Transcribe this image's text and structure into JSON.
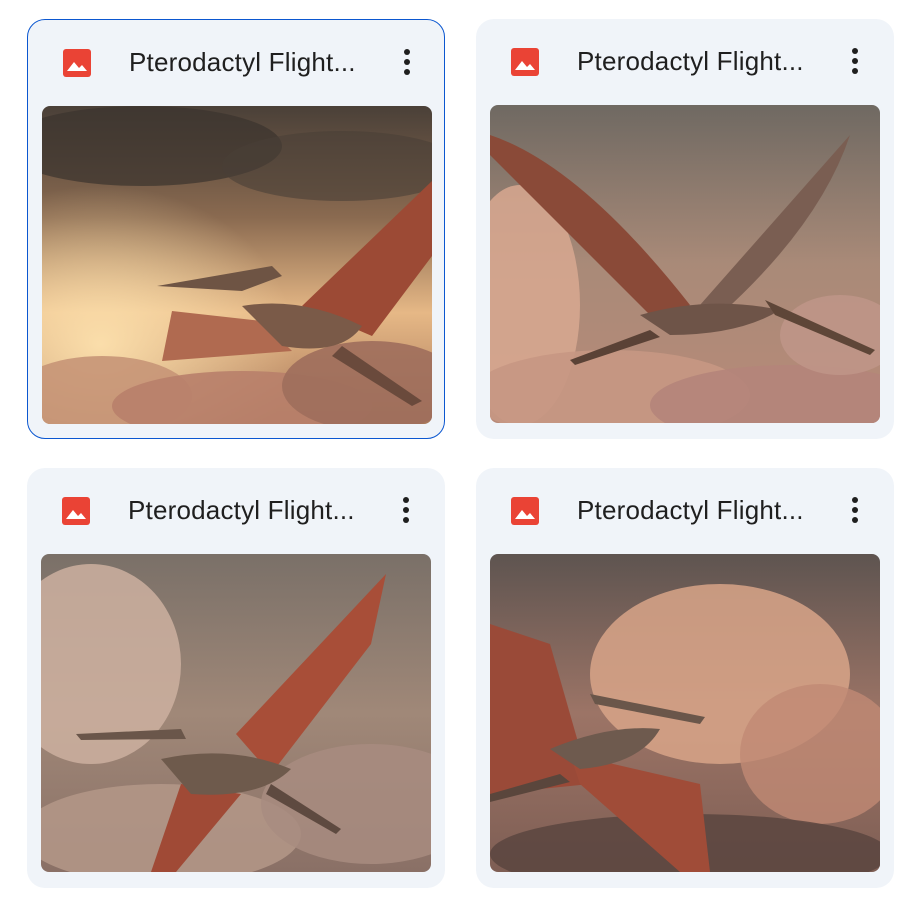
{
  "grid": {
    "files": [
      {
        "title": "Pterodactyl Flight...",
        "type_icon": "image-file-icon",
        "menu_icon": "more-vert-icon",
        "selected": true
      },
      {
        "title": "Pterodactyl Flight...",
        "type_icon": "image-file-icon",
        "menu_icon": "more-vert-icon",
        "selected": false
      },
      {
        "title": "Pterodactyl Flight...",
        "type_icon": "image-file-icon",
        "menu_icon": "more-vert-icon",
        "selected": false
      },
      {
        "title": "Pterodactyl Flight...",
        "type_icon": "image-file-icon",
        "menu_icon": "more-vert-icon",
        "selected": false
      }
    ]
  },
  "colors": {
    "card_background": "#f0f4f9",
    "selected_border": "#0b57d0",
    "image_icon": "#ea4335",
    "title_text": "#1f1f1f"
  }
}
